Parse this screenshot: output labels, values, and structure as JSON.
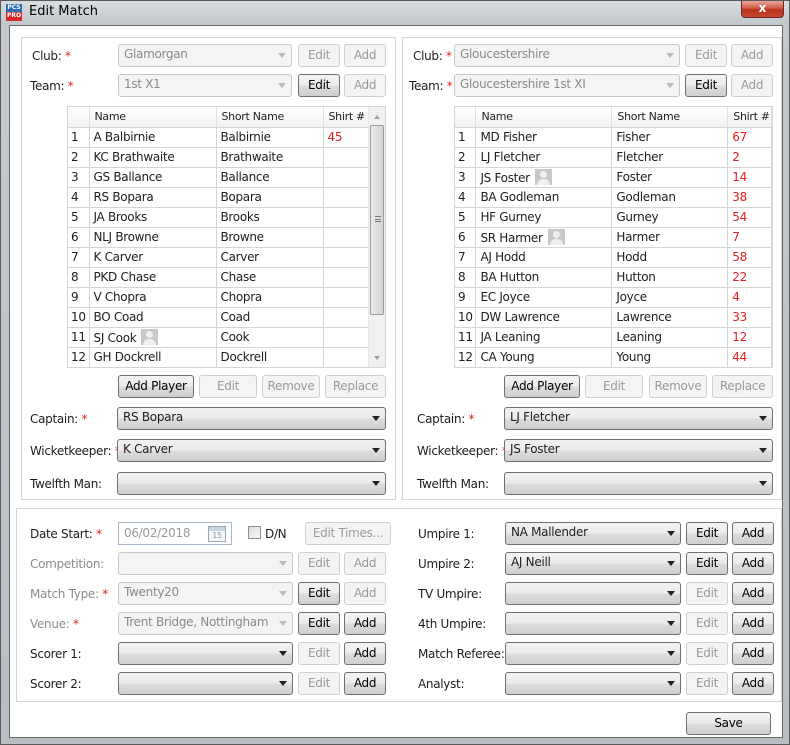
{
  "window": {
    "title": "Edit Match",
    "app_icon": {
      "top": "PCS",
      "bottom": "PRO"
    },
    "close_label": "x"
  },
  "home": {
    "club_label": "Club:",
    "club_value": "Glamorgan",
    "team_label": "Team:",
    "team_value": "1st X1",
    "edit_label": "Edit",
    "add_label": "Add",
    "columns": [
      "",
      "Name",
      "Short Name",
      "Shirt #"
    ],
    "players": [
      {
        "n": "1",
        "name": "A Balbirnie",
        "short": "Balbirnie",
        "shirt": "45",
        "avatar": false
      },
      {
        "n": "2",
        "name": "KC Brathwaite",
        "short": "Brathwaite",
        "shirt": "",
        "avatar": false
      },
      {
        "n": "3",
        "name": "GS Ballance",
        "short": "Ballance",
        "shirt": "",
        "avatar": false
      },
      {
        "n": "4",
        "name": "RS Bopara",
        "short": "Bopara",
        "shirt": "",
        "avatar": false
      },
      {
        "n": "5",
        "name": "JA Brooks",
        "short": "Brooks",
        "shirt": "",
        "avatar": false
      },
      {
        "n": "6",
        "name": "NLJ Browne",
        "short": "Browne",
        "shirt": "",
        "avatar": false
      },
      {
        "n": "7",
        "name": "K Carver",
        "short": "Carver",
        "shirt": "",
        "avatar": false
      },
      {
        "n": "8",
        "name": "PKD Chase",
        "short": "Chase",
        "shirt": "",
        "avatar": false
      },
      {
        "n": "9",
        "name": "V Chopra",
        "short": "Chopra",
        "shirt": "",
        "avatar": false
      },
      {
        "n": "10",
        "name": "BO Coad",
        "short": "Coad",
        "shirt": "",
        "avatar": false
      },
      {
        "n": "11",
        "name": "SJ Cook",
        "short": "Cook",
        "shirt": "",
        "avatar": true
      },
      {
        "n": "12",
        "name": "GH Dockrell",
        "short": "Dockrell",
        "shirt": "",
        "avatar": false
      }
    ],
    "buttons": {
      "add_player": "Add Player",
      "edit": "Edit",
      "remove": "Remove",
      "replace": "Replace"
    },
    "captain_label": "Captain:",
    "captain_value": "RS Bopara",
    "wicketkeeper_label": "Wicketkeeper:",
    "wicketkeeper_value": "K Carver",
    "twelfth_label": "Twelfth Man:",
    "twelfth_value": ""
  },
  "away": {
    "club_label": "Club:",
    "club_value": "Gloucestershire",
    "team_label": "Team:",
    "team_value": "Gloucestershire 1st XI",
    "edit_label": "Edit",
    "add_label": "Add",
    "columns": [
      "",
      "Name",
      "Short Name",
      "Shirt #"
    ],
    "players": [
      {
        "n": "1",
        "name": "MD Fisher",
        "short": "Fisher",
        "shirt": "67",
        "avatar": false
      },
      {
        "n": "2",
        "name": "LJ Fletcher",
        "short": "Fletcher",
        "shirt": "2",
        "avatar": false
      },
      {
        "n": "3",
        "name": "JS Foster",
        "short": "Foster",
        "shirt": "14",
        "avatar": true
      },
      {
        "n": "4",
        "name": "BA Godleman",
        "short": "Godleman",
        "shirt": "38",
        "avatar": false
      },
      {
        "n": "5",
        "name": "HF Gurney",
        "short": "Gurney",
        "shirt": "54",
        "avatar": false
      },
      {
        "n": "6",
        "name": "SR Harmer",
        "short": "Harmer",
        "shirt": "7",
        "avatar": true
      },
      {
        "n": "7",
        "name": "AJ Hodd",
        "short": "Hodd",
        "shirt": "58",
        "avatar": false
      },
      {
        "n": "8",
        "name": "BA Hutton",
        "short": "Hutton",
        "shirt": "22",
        "avatar": false
      },
      {
        "n": "9",
        "name": "EC Joyce",
        "short": "Joyce",
        "shirt": "4",
        "avatar": false
      },
      {
        "n": "10",
        "name": "DW Lawrence",
        "short": "Lawrence",
        "shirt": "33",
        "avatar": false
      },
      {
        "n": "11",
        "name": "JA Leaning",
        "short": "Leaning",
        "shirt": "12",
        "avatar": false
      },
      {
        "n": "12",
        "name": "CA Young",
        "short": "Young",
        "shirt": "44",
        "avatar": false
      }
    ],
    "buttons": {
      "add_player": "Add Player",
      "edit": "Edit",
      "remove": "Remove",
      "replace": "Replace"
    },
    "captain_label": "Captain:",
    "captain_value": "LJ Fletcher",
    "wicketkeeper_label": "Wicketkeeper:",
    "wicketkeeper_value": "JS Foster",
    "twelfth_label": "Twelfth Man:",
    "twelfth_value": ""
  },
  "match": {
    "required_mark": "*",
    "date_label": "Date Start:",
    "date_value": "06/02/2018",
    "calendar_day": "15",
    "dn_label": "D/N",
    "dn_checked": false,
    "edit_times_label": "Edit Times...",
    "edit_label": "Edit",
    "add_label": "Add",
    "left_rows": [
      {
        "label": "Competition:",
        "value": "",
        "required": false
      },
      {
        "label": "Match Type:",
        "value": "Twenty20",
        "required": true
      },
      {
        "label": "Venue:",
        "value": "Trent Bridge, Nottingham",
        "required": true
      },
      {
        "label": "Scorer 1:",
        "value": "",
        "required": false
      },
      {
        "label": "Scorer 2:",
        "value": "",
        "required": false
      }
    ],
    "right_rows": [
      {
        "label": "Umpire 1:",
        "value": "NA Mallender"
      },
      {
        "label": "Umpire 2:",
        "value": "AJ Neill"
      },
      {
        "label": "TV Umpire:",
        "value": ""
      },
      {
        "label": "4th Umpire:",
        "value": ""
      },
      {
        "label": "Match Referee:",
        "value": ""
      },
      {
        "label": "Analyst:",
        "value": ""
      }
    ]
  },
  "footer": {
    "save_label": "Save"
  },
  "colors": {
    "required": "#e02020",
    "shirt_number": "#e02020"
  }
}
